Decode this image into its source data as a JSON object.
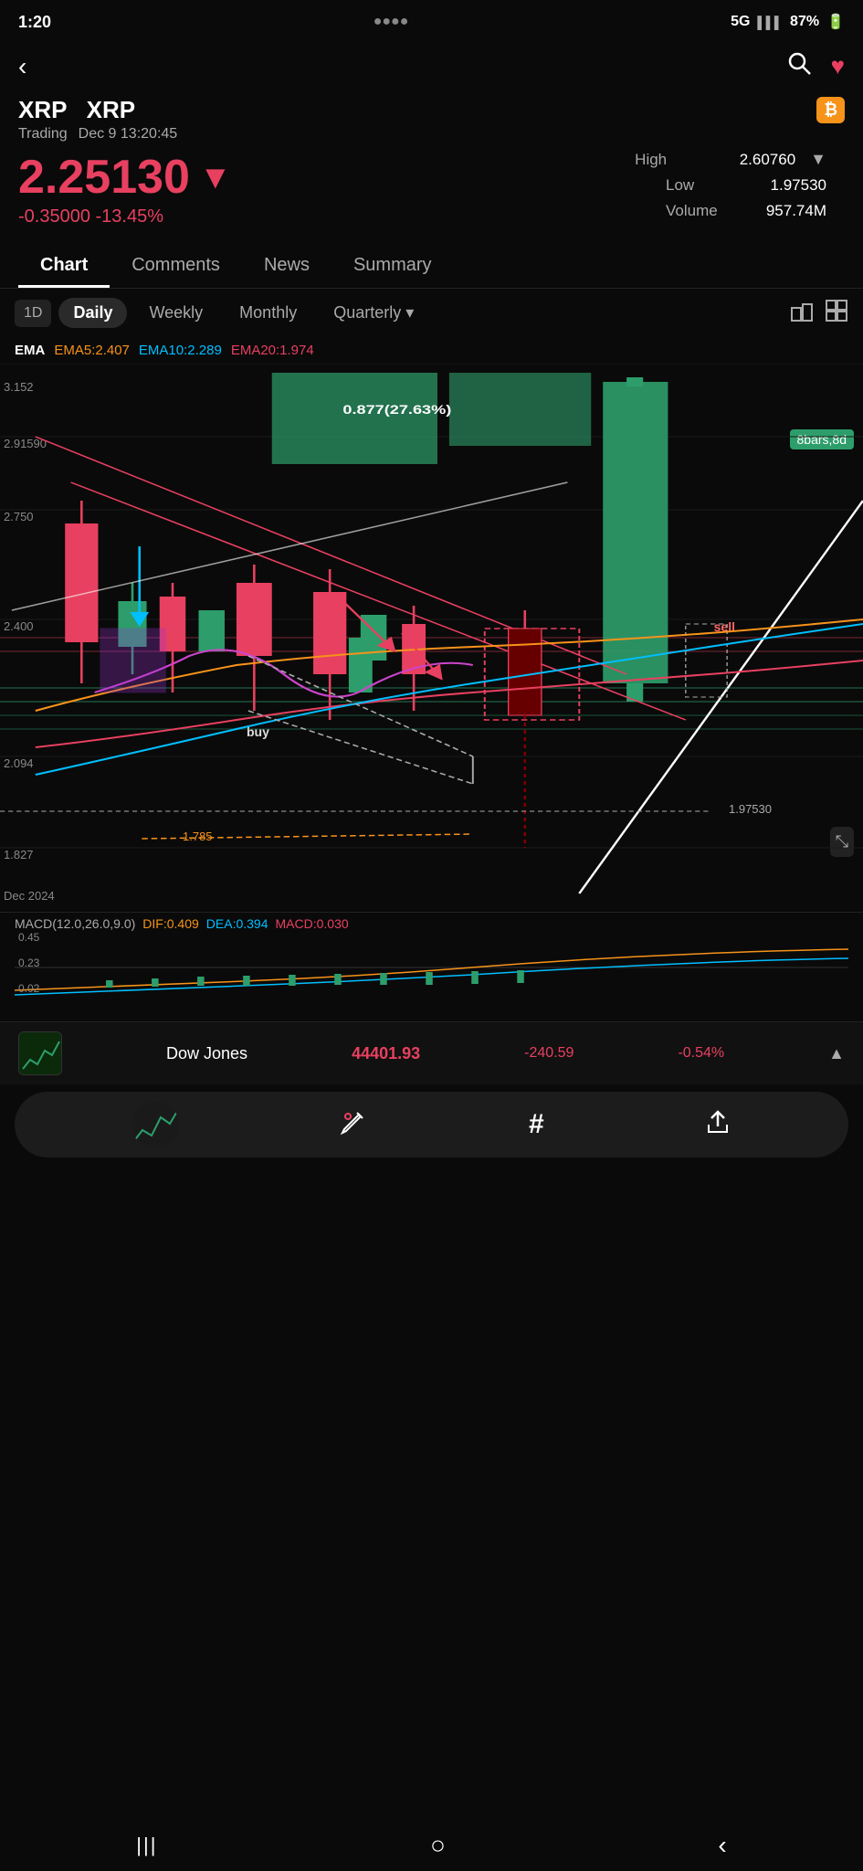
{
  "statusBar": {
    "time": "1:20",
    "signal": "5G",
    "battery": "87%"
  },
  "header": {
    "backLabel": "‹",
    "searchIcon": "🔍",
    "heartIcon": "♥"
  },
  "asset": {
    "symbol": "XRP",
    "name": "XRP",
    "tradingLabel": "Trading",
    "tradingTime": "Dec 9 13:20:45",
    "badgeIcon": "₿"
  },
  "price": {
    "value": "2.25130",
    "arrow": "▼",
    "change": "-0.35000 -13.45%",
    "high": "2.60760",
    "low": "1.97530",
    "volume": "957.74M",
    "highLabel": "High",
    "lowLabel": "Low",
    "volumeLabel": "Volume"
  },
  "tabs": [
    {
      "label": "Chart",
      "active": true
    },
    {
      "label": "Comments",
      "active": false
    },
    {
      "label": "News",
      "active": false
    },
    {
      "label": "Summary",
      "active": false
    }
  ],
  "chartControls": {
    "timeBox": "1D",
    "periods": [
      {
        "label": "Daily",
        "active": true
      },
      {
        "label": "Weekly",
        "active": false
      },
      {
        "label": "Monthly",
        "active": false
      },
      {
        "label": "Quarterly",
        "active": false,
        "hasDropdown": true
      }
    ],
    "tools": [
      "⚖",
      "⊞"
    ]
  },
  "ema": {
    "base": "EMA",
    "ema5": "EMA5:2.407",
    "ema10": "EMA10:2.289",
    "ema20": "EMA20:1.974"
  },
  "chartAnnotations": {
    "bars8d": "8bars,8d",
    "sell": "sell",
    "buy": "buy",
    "level1785": "1.785",
    "level1975": "1.97530",
    "priceLabels": [
      "3.152",
      "2.91590",
      "2.750",
      "2.400",
      "2.094",
      "1.827"
    ],
    "dateLabel": "Dec 2024"
  },
  "macd": {
    "header": "MACD(12.0,26.0,9.0)",
    "dif": "DIF:0.409",
    "dea": "DEA:0.394",
    "macd": "MACD:0.030",
    "levels": [
      "0.45",
      "0.23",
      "0.02"
    ]
  },
  "bottomTicker": {
    "name": "Dow Jones",
    "price": "44401.93",
    "change": "-240.59",
    "pct": "-0.54%"
  },
  "bottomNav": {
    "editIcon": "✏",
    "hashIcon": "#",
    "shareIcon": "⬆"
  },
  "androidNav": {
    "menuIcon": "|||",
    "homeIcon": "○",
    "backIcon": "‹"
  }
}
